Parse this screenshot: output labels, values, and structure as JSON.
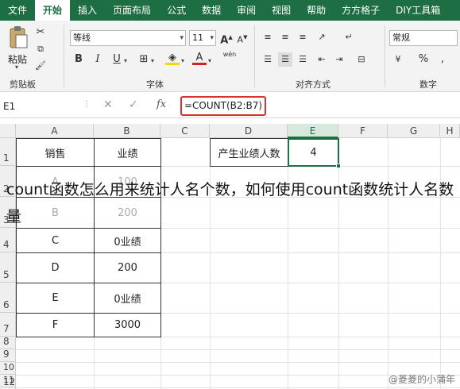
{
  "tabs": [
    "文件",
    "开始",
    "插入",
    "页面布局",
    "公式",
    "数据",
    "审阅",
    "视图",
    "帮助",
    "方方格子",
    "DIY工具箱"
  ],
  "ribbon": {
    "clipboard_label": "剪贴板",
    "paste_label": "粘贴",
    "font_name": "等线",
    "font_size": "11",
    "font_label": "字体",
    "align_label": "对齐方式",
    "number_format": "常规",
    "number_label": "数字",
    "bold": "B",
    "italic": "I",
    "underline": "U",
    "font_color_glyph": "A",
    "grow_font": "A",
    "shrink_font": "A",
    "wen_glyph": "wén",
    "percent": "%",
    "comma": ","
  },
  "formula_bar": {
    "name_box": "E1",
    "fx": "fx",
    "formula": "=COUNT(B2:B7)"
  },
  "columns": [
    "A",
    "B",
    "C",
    "D",
    "E",
    "F",
    "G",
    "H"
  ],
  "rows": [
    "1",
    "2",
    "3",
    "4",
    "5",
    "6",
    "7",
    "8",
    "9",
    "10",
    "11",
    "12"
  ],
  "table": {
    "headers": [
      "销售",
      "业绩"
    ],
    "rows": [
      [
        "A",
        "100"
      ],
      [
        "B",
        "200"
      ],
      [
        "C",
        "0业绩"
      ],
      [
        "D",
        "200"
      ],
      [
        "E",
        "0业绩"
      ],
      [
        "F",
        "3000"
      ]
    ]
  },
  "result": {
    "label": "产生业绩人数",
    "value": "4"
  },
  "overlay_title": "count函数怎么用来统计人名个数，如何使用count函数统计人名数量",
  "watermark": "@菱菱的小蒲年"
}
